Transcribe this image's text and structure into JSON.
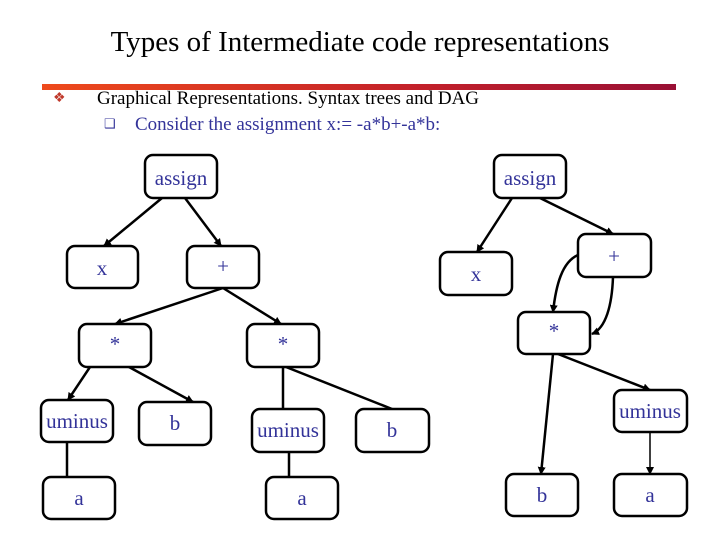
{
  "slide": {
    "title": "Types of Intermediate code representations",
    "bullet": "Graphical Representations. Syntax trees and DAG",
    "sub_bullet": "Consider the assignment x:= -a*b+-a*b:",
    "bullet_icon": "diamond-dots-icon",
    "sub_bullet_icon": "hollow-square-icon",
    "text_color": "#333399",
    "bar_colors": [
      "#ee4a1c",
      "#991035"
    ]
  },
  "syntax_tree": {
    "nodes": {
      "assign": "assign",
      "x": "x",
      "plus": "+",
      "mulL": "*",
      "mulR": "*",
      "uminusL": "uminus",
      "bL": "b",
      "uminusR": "uminus",
      "bR": "b",
      "aL": "a",
      "aR": "a"
    }
  },
  "dag": {
    "nodes": {
      "assign": "assign",
      "x": "x",
      "plus": "+",
      "mul": "*",
      "uminus": "uminus",
      "b": "b",
      "a": "a"
    }
  }
}
